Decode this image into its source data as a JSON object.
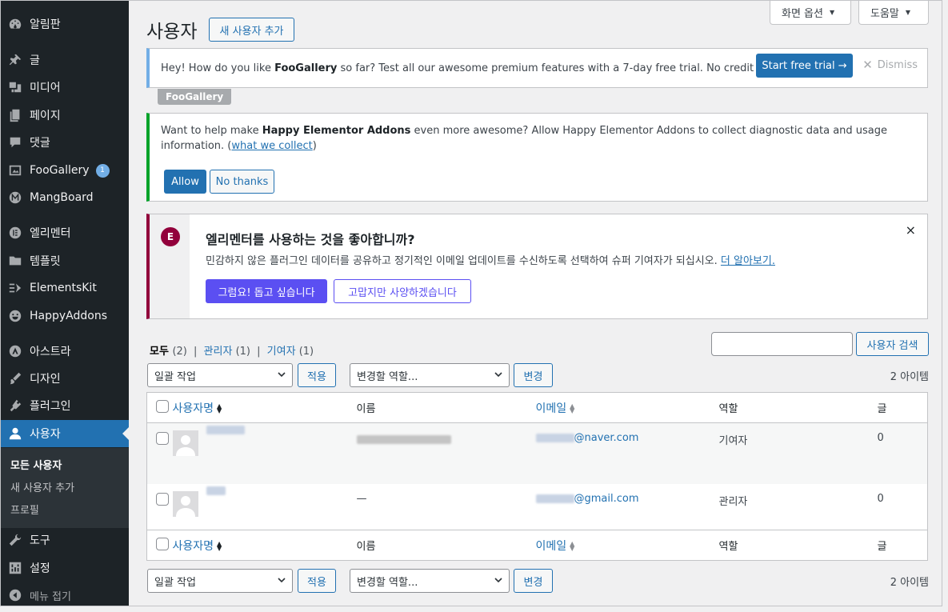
{
  "sidebar": {
    "items": [
      {
        "label": "알림판",
        "icon": "dashboard-icon"
      },
      {
        "label": "글",
        "icon": "pin-icon"
      },
      {
        "label": "미디어",
        "icon": "media-icon"
      },
      {
        "label": "페이지",
        "icon": "page-icon"
      },
      {
        "label": "댓글",
        "icon": "comment-icon"
      },
      {
        "label": "FooGallery",
        "icon": "gallery-icon",
        "badge": "1"
      },
      {
        "label": "MangBoard",
        "icon": "mangboard-icon"
      },
      {
        "label": "엘리멘터",
        "icon": "elementor-icon"
      },
      {
        "label": "템플릿",
        "icon": "folder-icon"
      },
      {
        "label": "ElementsKit",
        "icon": "elementskit-icon"
      },
      {
        "label": "HappyAddons",
        "icon": "happy-icon"
      },
      {
        "label": "아스트라",
        "icon": "astra-icon"
      },
      {
        "label": "디자인",
        "icon": "brush-icon"
      },
      {
        "label": "플러그인",
        "icon": "plugin-icon"
      },
      {
        "label": "사용자",
        "icon": "user-icon"
      },
      {
        "label": "도구",
        "icon": "wrench-icon"
      },
      {
        "label": "설정",
        "icon": "settings-icon"
      }
    ],
    "submenu": [
      "모든 사용자",
      "새 사용자 추가",
      "프로필"
    ],
    "collapse": "메뉴 접기"
  },
  "top": {
    "screen_options": "화면 옵션",
    "help": "도움말"
  },
  "page": {
    "title": "사용자",
    "add_new": "새 사용자 추가"
  },
  "notices": {
    "foo": {
      "pre": "Hey! How do you like ",
      "brand": "FooGallery",
      "post": " so far? Test all our awesome premium features with a 7-day free trial. No credit card required!",
      "cta": "Start free trial →",
      "dismiss": "Dismiss",
      "tag": "FooGallery"
    },
    "happy": {
      "pre": "Want to help make ",
      "brand": "Happy Elementor Addons",
      "post": " even more awesome? Allow Happy Elementor Addons to collect diagnostic data and usage information. (",
      "link": "what we collect",
      "end": ")",
      "allow": "Allow",
      "no": "No thanks"
    },
    "elementor": {
      "title": "엘리멘터를 사용하는 것을 좋아합니까?",
      "desc": "민감하지 않은 플러그인 데이터를 공유하고 정기적인 이메일 업데이트를 수신하도록 선택하여 슈퍼 기여자가 되십시오. ",
      "link": "더 알아보기.",
      "yes": "그럼요! 돕고 싶습니다",
      "no": "고맙지만 사양하겠습니다",
      "close": "×",
      "logo": "E"
    }
  },
  "filters": {
    "all": "모두",
    "all_count": "(2)",
    "admin": "관리자",
    "admin_count": "(1)",
    "contrib": "기여자",
    "contrib_count": "(1)",
    "sep": "|",
    "search_button": "사용자 검색"
  },
  "bulk": {
    "action": "일괄 작업",
    "apply": "적용",
    "role": "변경할 역할...",
    "change": "변경",
    "count": "2 아이템"
  },
  "table": {
    "headers": {
      "username": "사용자명",
      "name": "이름",
      "email": "이메일",
      "role": "역할",
      "posts": "글"
    },
    "rows": [
      {
        "email_suffix": "@naver.com",
        "name": "",
        "role": "기여자",
        "posts": "0"
      },
      {
        "email_suffix": "@gmail.com",
        "name": "—",
        "role": "관리자",
        "posts": "0"
      }
    ]
  }
}
